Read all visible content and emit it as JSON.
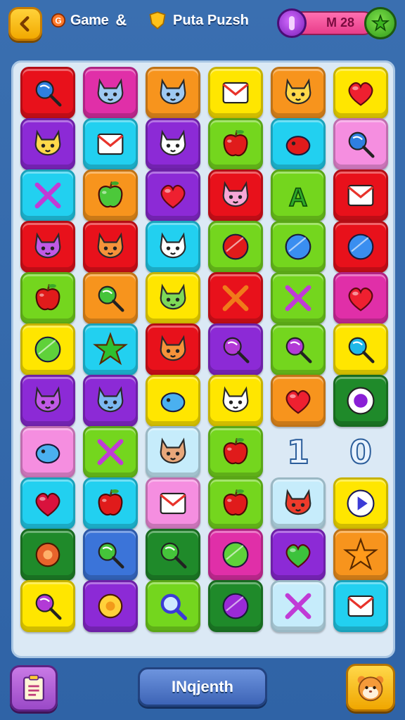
{
  "header": {
    "back_icon": "chevron-left-icon",
    "title": "Game",
    "title_icon": "badge-icon",
    "title_suffix": "&",
    "subtitle": "Puta Puzsh",
    "subtitle_icon": "shield-icon",
    "currency_value": "M 28",
    "currency_icon": "gem-coin-icon",
    "add_icon": "plus-star-icon"
  },
  "colors": {
    "red": "#e8111b",
    "magenta": "#e02fa8",
    "orange": "#f7941d",
    "yellow": "#ffe600",
    "purple": "#8c2ad6",
    "cyan": "#22d0f0",
    "green": "#74d61e",
    "pink": "#f58ee0",
    "lightblue": "#c6ecfb",
    "darkgreen": "#1f8a2a",
    "blue": "#3b74d9"
  },
  "board": {
    "rows": [
      [
        {
          "color": "red",
          "icon": "blue-lollipop-icon"
        },
        {
          "color": "magenta",
          "icon": "cat-face-icon"
        },
        {
          "color": "orange",
          "icon": "cat-face-icon"
        },
        {
          "color": "yellow",
          "icon": "block-t-icon"
        },
        {
          "color": "orange",
          "icon": "hamster-face-icon"
        },
        {
          "color": "yellow",
          "icon": "heart-icon"
        }
      ],
      [
        {
          "color": "purple",
          "icon": "hat-face-icon"
        },
        {
          "color": "cyan",
          "icon": "envelope-icon"
        },
        {
          "color": "purple",
          "icon": "white-cat-icon"
        },
        {
          "color": "green",
          "icon": "apple-icon"
        },
        {
          "color": "cyan",
          "icon": "red-gift-icon"
        },
        {
          "color": "pink",
          "icon": "blue-candy-icon"
        }
      ],
      [
        {
          "color": "cyan",
          "icon": "pencil-icon"
        },
        {
          "color": "orange",
          "icon": "green-apple-icon"
        },
        {
          "color": "purple",
          "icon": "heart-icon"
        },
        {
          "color": "red",
          "icon": "pig-face-icon"
        },
        {
          "color": "green",
          "icon": "letter-a-icon"
        },
        {
          "color": "red",
          "icon": "bar-blocks-icon"
        }
      ],
      [
        {
          "color": "red",
          "icon": "purple-monster-icon"
        },
        {
          "color": "red",
          "icon": "orange-cat-icon"
        },
        {
          "color": "cyan",
          "icon": "white-cat-icon"
        },
        {
          "color": "green",
          "icon": "red-balloon-icon"
        },
        {
          "color": "green",
          "icon": "blue-ball-icon"
        },
        {
          "color": "red",
          "icon": "blue-ball-icon"
        }
      ],
      [
        {
          "color": "green",
          "icon": "apple-icon"
        },
        {
          "color": "orange",
          "icon": "green-lollipop-icon"
        },
        {
          "color": "yellow",
          "icon": "green-cat-icon"
        },
        {
          "color": "red",
          "icon": "orange-x-icon"
        },
        {
          "color": "green",
          "icon": "purple-z-icon"
        },
        {
          "color": "magenta",
          "icon": "heart-icon"
        }
      ],
      [
        {
          "color": "yellow",
          "icon": "green-blob-icon"
        },
        {
          "color": "cyan",
          "icon": "star-icon"
        },
        {
          "color": "red",
          "icon": "orange-cat-icon"
        },
        {
          "color": "purple",
          "icon": "purple-candy-icon"
        },
        {
          "color": "green",
          "icon": "purple-candy-icon"
        },
        {
          "color": "yellow",
          "icon": "cyan-candy-icon"
        }
      ],
      [
        {
          "color": "purple",
          "icon": "purple-cat-icon"
        },
        {
          "color": "purple",
          "icon": "blue-cat-icon"
        },
        {
          "color": "yellow",
          "icon": "blue-bird-icon"
        },
        {
          "color": "yellow",
          "icon": "white-cat-icon"
        },
        {
          "color": "orange",
          "icon": "heart-icon"
        },
        {
          "color": "darkgreen",
          "icon": "purple-donut-icon"
        }
      ],
      [
        {
          "color": "pink",
          "icon": "blue-fish-icon"
        },
        {
          "color": "green",
          "icon": "no-sign-icon"
        },
        {
          "color": "lightblue",
          "icon": "girl-face-icon"
        },
        {
          "color": "green",
          "icon": "apple-icon"
        },
        {
          "color": "none",
          "icon": "",
          "text": "1"
        },
        {
          "color": "none",
          "icon": "",
          "text": "0"
        }
      ],
      [
        {
          "color": "cyan",
          "icon": "red-heart-gem-icon"
        },
        {
          "color": "cyan",
          "icon": "apple-icon"
        },
        {
          "color": "pink",
          "icon": "document-icon"
        },
        {
          "color": "green",
          "icon": "apple-icon"
        },
        {
          "color": "lightblue",
          "icon": "red-bear-icon"
        },
        {
          "color": "yellow",
          "icon": "play-icon"
        }
      ],
      [
        {
          "color": "darkgreen",
          "icon": "swirl-icon"
        },
        {
          "color": "blue",
          "icon": "green-candy-icon"
        },
        {
          "color": "darkgreen",
          "icon": "green-candy-icon"
        },
        {
          "color": "magenta",
          "icon": "green-ball-icon"
        },
        {
          "color": "purple",
          "icon": "green-heart-icon"
        },
        {
          "color": "orange",
          "icon": "sun-icon"
        }
      ],
      [
        {
          "color": "yellow",
          "icon": "purple-candy-icon"
        },
        {
          "color": "purple",
          "icon": "flower-icon"
        },
        {
          "color": "green",
          "icon": "magnifier-icon"
        },
        {
          "color": "darkgreen",
          "icon": "purple-ball-icon"
        },
        {
          "color": "lightblue",
          "icon": "x-cross-icon"
        },
        {
          "color": "cyan",
          "icon": "envelope-icon"
        }
      ]
    ]
  },
  "footer": {
    "menu_icon": "clipboard-icon",
    "main_label": "INqjenth",
    "pet_icon": "hamster-face-icon"
  }
}
